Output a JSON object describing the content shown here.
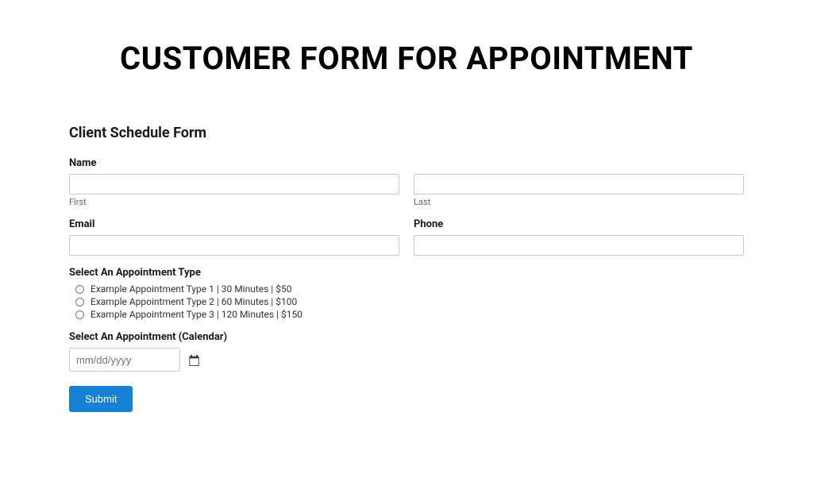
{
  "page_title": "CUSTOMER FORM FOR APPOINTMENT",
  "form": {
    "heading": "Client Schedule Form",
    "name_label": "Name",
    "first_sublabel": "First",
    "last_sublabel": "Last",
    "email_label": "Email",
    "phone_label": "Phone",
    "appointment_type_label": "Select An Appointment Type",
    "appointment_options": [
      "Example Appointment Type 1 | 30 Minutes | $50",
      "Example Appointment Type 2 | 60 Minutes | $100",
      "Example Appointment Type 3 | 120 Minutes | $150"
    ],
    "calendar_label": "Select An Appointment (Calendar)",
    "date_placeholder": "mm/dd/yyyy",
    "submit_label": "Submit"
  }
}
